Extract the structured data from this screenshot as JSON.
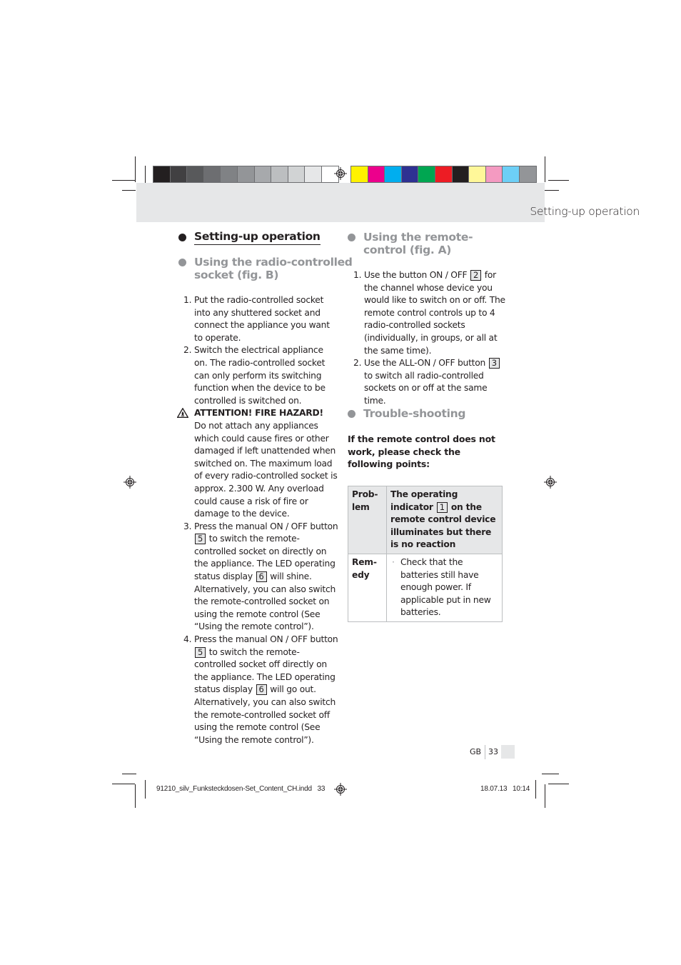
{
  "color_bar": {
    "grays": [
      "#231f20",
      "#414042",
      "#58595b",
      "#6d6e71",
      "#808285",
      "#939598",
      "#a7a9ac",
      "#bcbec0",
      "#d1d3d4",
      "#e6e7e8",
      "#ffffff"
    ],
    "colors": [
      "#fff200",
      "#ec008c",
      "#00aeef",
      "#2e3192",
      "#00a651",
      "#ed1c24",
      "#231f20",
      "#fff799",
      "#f49ac1",
      "#6dcff6",
      "#939598"
    ]
  },
  "header": {
    "section_title": "Setting-up operation"
  },
  "left": {
    "main_heading": "Setting-up operation",
    "sub_heading": "Using the radio-controlled socket (fig. B)",
    "sub_heading_line1": "Using the radio-controlled",
    "sub_heading_line2": "socket (fig. B)",
    "steps": [
      {
        "num": "1.",
        "text": "Put the radio-controlled socket into any shuttered socket and connect the appliance you want to operate."
      },
      {
        "num": "2.",
        "text": "Switch the electrical appliance on. The radio-controlled socket can only perform its switching function when the device to be controlled is switched on."
      }
    ],
    "warning": {
      "icon": "fire-hazard-warning-icon",
      "title": "ATTENTION! FIRE HAZARD!",
      "text": "Do not attach any appliances which could cause fires or other damaged if left unattended when switched on. The maximum load of every radio-controlled socket is approx. 2.300 W. Any overload could cause a risk of fire or damage to the device."
    },
    "step3": {
      "num": "3.",
      "a": "Press the manual ON / OFF button",
      "ref1": "5",
      "b": "to switch the remote-controlled socket on directly on the appliance. The LED operating status display",
      "ref2": "6",
      "c": "will shine. Alternatively, you can also switch the remote-controlled socket on using the remote control (See “Using the remote control”)."
    },
    "step4": {
      "num": "4.",
      "a": "Press the manual ON / OFF button",
      "ref1": "5",
      "b": "to switch the remote-controlled socket off directly on the appliance. The LED operating status display",
      "ref2": "6",
      "c": "will go out. Alternatively, you can also switch the remote-controlled socket off using the remote control (See “Using the remote control”)."
    }
  },
  "right": {
    "remote_heading_line1": "Using the remote-",
    "remote_heading_line2": "control (fig. A)",
    "step1": {
      "num": "1.",
      "a": "Use the button ON / OFF",
      "ref": "2",
      "b": "for the channel whose device you would like to switch on or off. The remote control controls up to 4 radio-controlled sockets (individually, in groups, or all at the same time)."
    },
    "step2": {
      "num": "2.",
      "a": "Use the ALL-ON / OFF button",
      "ref": "3",
      "b": "to switch all radio-controlled sockets on or off at the same time."
    },
    "trouble_heading": "Trouble-shooting",
    "trouble_lead": "If the remote control does not work, please check the following points:",
    "table": {
      "problem_label": "Prob-lem",
      "problem_a": "The operating indicator",
      "problem_ref": "1",
      "problem_b": "on the remote control device illuminates but there is no reaction",
      "remedy_label": "Rem-edy",
      "remedy_bullet": "·",
      "remedy_text": "Check that the batteries still have enough power. If applicable put in new batteries."
    }
  },
  "footer": {
    "language": "GB",
    "page": "33",
    "slug_file": "91210_silv_Funksteckdosen-Set_Content_CH.indd   33",
    "slug_date": "18.07.13   10:14"
  }
}
